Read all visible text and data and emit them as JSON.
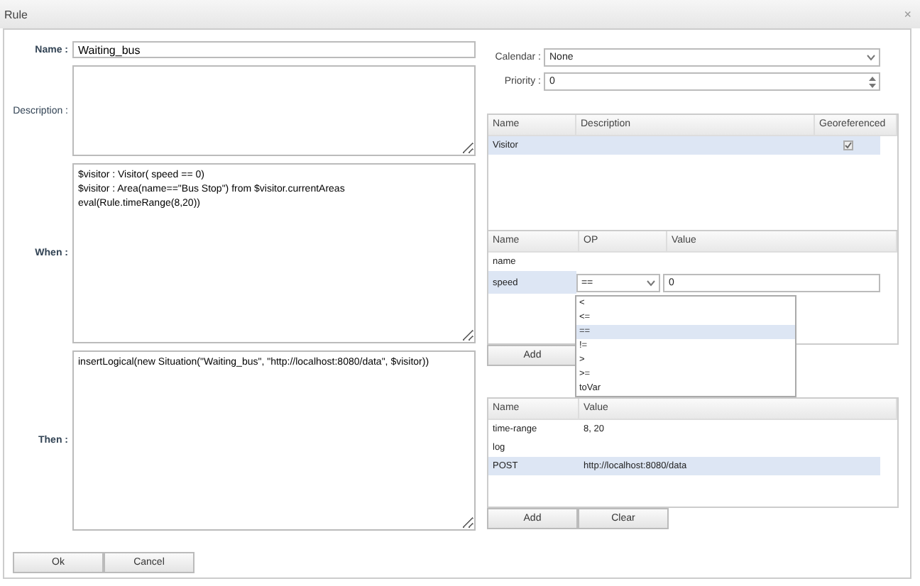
{
  "window": {
    "title": "Rule",
    "close": "×"
  },
  "fields": {
    "name_label": "Name :",
    "name": "Waiting_bus",
    "description_label": "Description :",
    "when_label": "When :",
    "when": "$visitor : Visitor( speed == 0)\n$visitor : Area(name==\"Bus Stop\") from $visitor.currentAreas\neval(Rule.timeRange(8,20))",
    "then_label": "Then :",
    "then": "insertLogical(new Situation(\"Waiting_bus\", \"http://localhost:8080/data\", $visitor))"
  },
  "buttons": [
    "Ok",
    "Cancel"
  ],
  "calendar": {
    "label": "Calendar :",
    "value": "None"
  },
  "priority": {
    "label": "Priority :",
    "value": "0"
  },
  "facts_table": {
    "columns": [
      "Name",
      "Description",
      "Georeferenced"
    ],
    "rows": [
      {
        "name": "Visitor",
        "georeferenced": true,
        "selected": true
      }
    ]
  },
  "conditions_table": {
    "columns": [
      "Name",
      "OP",
      "Value"
    ],
    "rows": [
      {
        "name": "name",
        "selected": false
      },
      {
        "name": "speed",
        "op": "==",
        "value": "0",
        "selected": true
      }
    ],
    "buttons": [
      "Add"
    ]
  },
  "op_dropdown": {
    "options": [
      {
        "label": "<",
        "selected": false
      },
      {
        "label": "<=",
        "selected": false
      },
      {
        "label": "==",
        "selected": true
      },
      {
        "label": "!=",
        "selected": false
      },
      {
        "label": ">",
        "selected": false
      },
      {
        "label": ">=",
        "selected": false
      },
      {
        "label": "toVar",
        "selected": false
      }
    ]
  },
  "actions_table": {
    "columns": [
      "Name",
      "Value"
    ],
    "rows": [
      {
        "name": "time-range",
        "value": "8, 20",
        "selected": false
      },
      {
        "name": "log",
        "selected": false
      },
      {
        "name": "POST",
        "value": "http://localhost:8080/data",
        "selected": true
      }
    ],
    "buttons": [
      "Add",
      "Clear"
    ]
  }
}
